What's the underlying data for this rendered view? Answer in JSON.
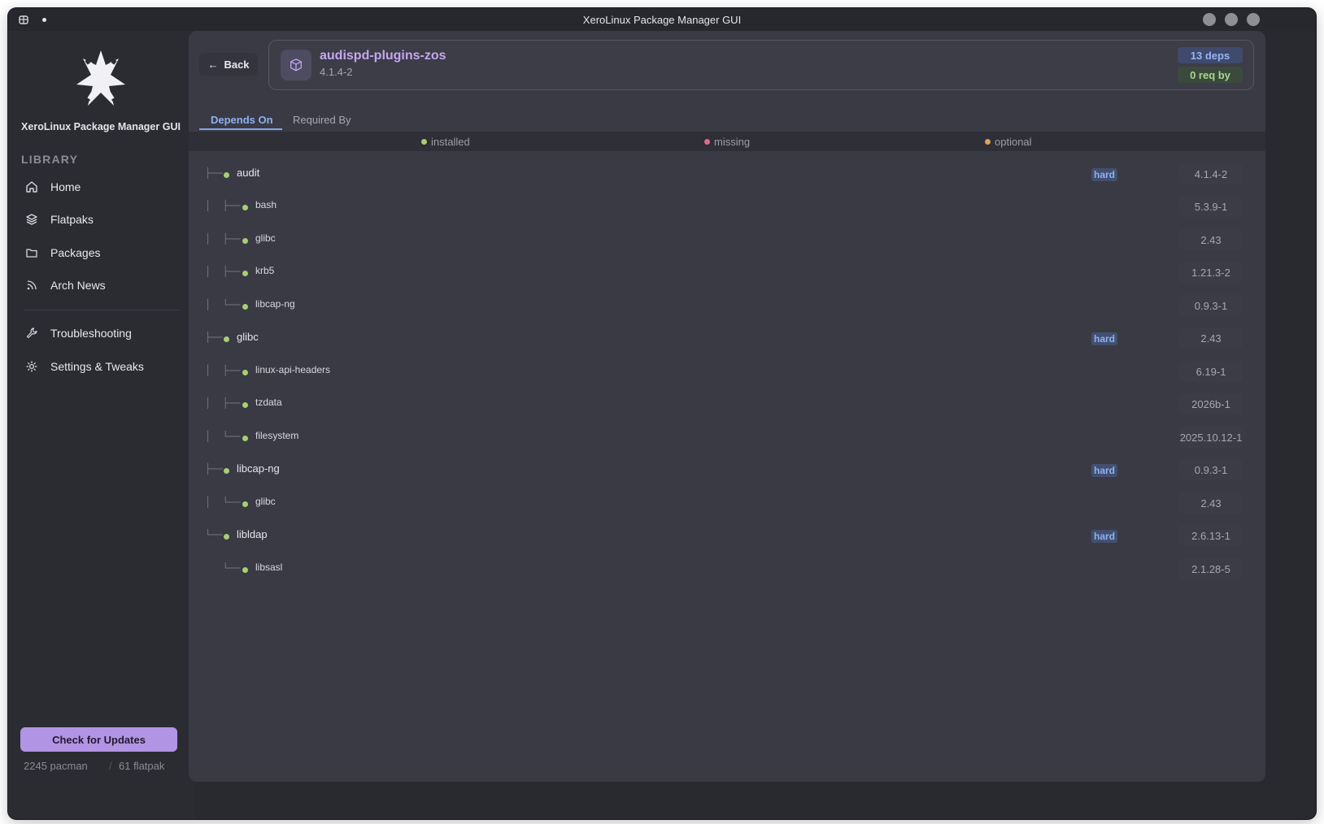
{
  "window": {
    "title": "XeroLinux Package Manager GUI"
  },
  "sidebar": {
    "app_name": "XeroLinux Package Manager GUI",
    "section_label": "LIBRARY",
    "items": [
      {
        "label": "Home",
        "icon": "home-icon"
      },
      {
        "label": "Flatpaks",
        "icon": "layers-icon"
      },
      {
        "label": "Packages",
        "icon": "folder-icon"
      },
      {
        "label": "Arch News",
        "icon": "rss-icon"
      },
      {
        "label": "Troubleshooting",
        "icon": "wrench-icon"
      },
      {
        "label": "Settings & Tweaks",
        "icon": "gear-icon"
      }
    ],
    "update_button": "Check for Updates",
    "pacman_count": "2245 pacman",
    "flatpak_count": "61 flatpak",
    "count_separator": "/"
  },
  "header": {
    "back_label": "Back",
    "package_name": "audispd-plugins-zos",
    "package_version": "4.1.4-2",
    "deps_badge": "13 deps",
    "reqby_badge": "0 req by"
  },
  "tabs": [
    {
      "label": "Depends On",
      "active": true
    },
    {
      "label": "Required By",
      "active": false
    }
  ],
  "legend": [
    {
      "label": "installed",
      "color": "#a7cf73"
    },
    {
      "label": "missing",
      "color": "#e06c85"
    },
    {
      "label": "optional",
      "color": "#e0a060"
    }
  ],
  "colors": {
    "accent": "#b294e4",
    "tab_active": "#8eb0ef",
    "installed": "#a7cf73"
  },
  "dependencies": [
    {
      "prefix": "├──",
      "name": "audit",
      "badge": "hard",
      "version": "4.1.4-2",
      "level": 0
    },
    {
      "prefix": "│  ├──",
      "name": "bash",
      "badge": "",
      "version": "5.3.9-1",
      "level": 1
    },
    {
      "prefix": "│  ├──",
      "name": "glibc",
      "badge": "",
      "version": "2.43",
      "level": 1
    },
    {
      "prefix": "│  ├──",
      "name": "krb5",
      "badge": "",
      "version": "1.21.3-2",
      "level": 1
    },
    {
      "prefix": "│  └──",
      "name": "libcap-ng",
      "badge": "",
      "version": "0.9.3-1",
      "level": 1
    },
    {
      "prefix": "├──",
      "name": "glibc",
      "badge": "hard",
      "version": "2.43",
      "level": 0
    },
    {
      "prefix": "│  ├──",
      "name": "linux-api-headers",
      "badge": "",
      "version": "6.19-1",
      "level": 1
    },
    {
      "prefix": "│  ├──",
      "name": "tzdata",
      "badge": "",
      "version": "2026b-1",
      "level": 1
    },
    {
      "prefix": "│  └──",
      "name": "filesystem",
      "badge": "",
      "version": "2025.10.12-1",
      "level": 1
    },
    {
      "prefix": "├──",
      "name": "libcap-ng",
      "badge": "hard",
      "version": "0.9.3-1",
      "level": 0
    },
    {
      "prefix": "│  └──",
      "name": "glibc",
      "badge": "",
      "version": "2.43",
      "level": 1
    },
    {
      "prefix": "└──",
      "name": "libldap",
      "badge": "hard",
      "version": "2.6.13-1",
      "level": 0
    },
    {
      "prefix": "   └──",
      "name": "libsasl",
      "badge": "",
      "version": "2.1.28-5",
      "level": 1
    }
  ]
}
